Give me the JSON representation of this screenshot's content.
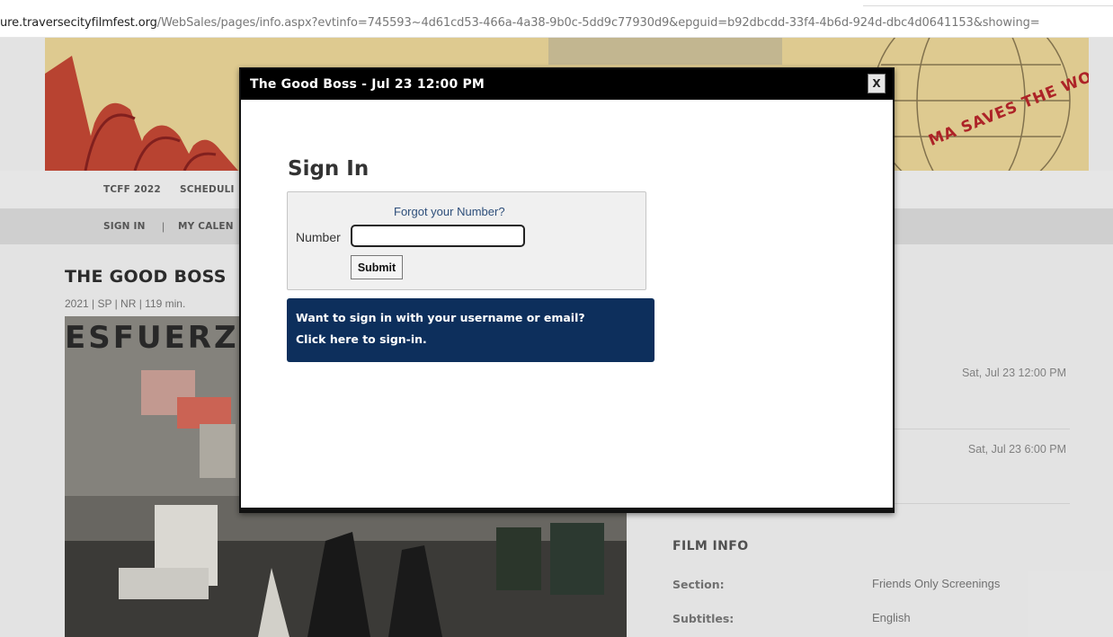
{
  "browser": {
    "url_host": "ure.traversecityfilmfest.org",
    "url_rest": "/WebSales/pages/info.aspx?evtinfo=745593~4d61cd53-466a-4a38-9b0c-5dd9c77930d9&epguid=b92dbcdd-33f4-4b6d-924d-dbc4d0641153&showing="
  },
  "banner": {
    "slogan": "MA SAVES THE WORLD!"
  },
  "nav": {
    "primary": [
      "TCFF 2022",
      "SCHEDULI"
    ],
    "secondary": [
      "SIGN IN",
      "|",
      "MY CALEN"
    ]
  },
  "film": {
    "title": "THE GOOD BOSS",
    "meta": "2021 | SP | NR | 119 min.",
    "poster_text": "ESFUERZO",
    "showtimes": [
      "Sat, Jul 23 12:00 PM",
      "Sat, Jul 23 6:00 PM"
    ],
    "info_heading": "FILM INFO",
    "info": [
      {
        "label": "Section:",
        "value": "Friends Only Screenings"
      },
      {
        "label": "Subtitles:",
        "value": "English"
      }
    ]
  },
  "modal": {
    "title": "The Good Boss - Jul 23 12:00 PM",
    "close_label": "X",
    "heading": "Sign In",
    "forgot_link": "Forgot your Number?",
    "number_label": "Number",
    "number_value": "",
    "submit_label": "Submit",
    "email_prompt": "Want to sign in with your username or email?",
    "email_link": "Click here to sign-in."
  },
  "colors": {
    "modal_header": "#000000",
    "email_box": "#0d2f5c",
    "banner": "#ecd79a",
    "slogan": "#b8262a"
  }
}
